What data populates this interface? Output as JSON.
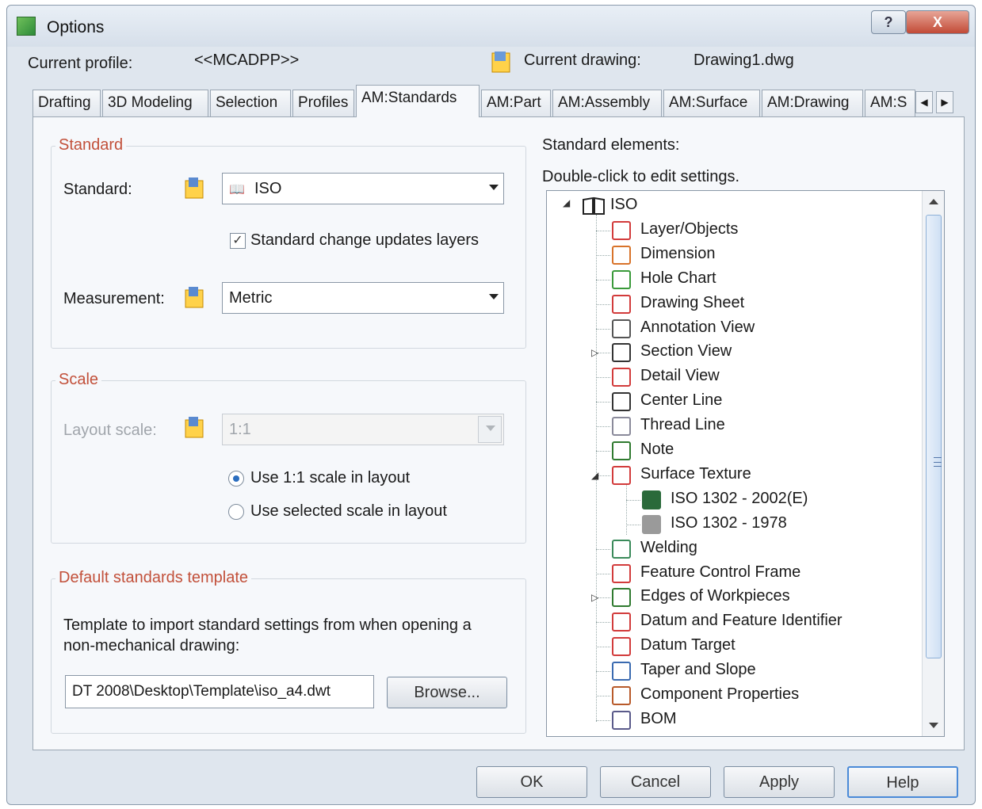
{
  "window": {
    "title": "Options"
  },
  "titlebar": {
    "help_glyph": "?",
    "close_glyph": "X"
  },
  "header": {
    "profile_label": "Current profile:",
    "profile_value": "<<MCADPP>>",
    "drawing_label": "Current drawing:",
    "drawing_value": "Drawing1.dwg"
  },
  "tabs": [
    {
      "label": "Drafting"
    },
    {
      "label": "3D Modeling"
    },
    {
      "label": "Selection"
    },
    {
      "label": "Profiles"
    },
    {
      "label": "AM:Standards",
      "active": true
    },
    {
      "label": "AM:Part"
    },
    {
      "label": "AM:Assembly"
    },
    {
      "label": "AM:Surface"
    },
    {
      "label": "AM:Drawing"
    },
    {
      "label": "AM:S"
    }
  ],
  "standard_group": {
    "heading": "Standard",
    "standard_label": "Standard:",
    "standard_value": "ISO",
    "checkbox_label": "Standard change updates layers",
    "checkbox_checked": true,
    "measurement_label": "Measurement:",
    "measurement_value": "Metric"
  },
  "scale_group": {
    "heading": "Scale",
    "layout_scale_label": "Layout scale:",
    "layout_scale_value": "1:1",
    "radio_1_label": "Use 1:1 scale in layout",
    "radio_2_label": "Use selected scale in layout",
    "selected_radio": 1
  },
  "template_group": {
    "heading": "Default standards template",
    "description_line1": "Template to import standard settings from when opening a",
    "description_line2": "non-mechanical drawing:",
    "path_value": "DT 2008\\Desktop\\Template\\iso_a4.dwt",
    "browse_label": "Browse..."
  },
  "elements": {
    "heading": "Standard elements:",
    "hint": "Double-click to edit settings.",
    "root": "ISO",
    "items": [
      {
        "label": "Layer/Objects",
        "icon": "layers-icon",
        "color": "#d23b3b"
      },
      {
        "label": "Dimension",
        "icon": "dimension-icon",
        "color": "#d8732a"
      },
      {
        "label": "Hole Chart",
        "icon": "hole-chart-icon",
        "color": "#3a9a3a"
      },
      {
        "label": "Drawing Sheet",
        "icon": "drawing-sheet-icon",
        "color": "#d23b3b"
      },
      {
        "label": "Annotation View",
        "icon": "annotation-view-icon",
        "color": "#555555"
      },
      {
        "label": "Section View",
        "icon": "section-view-icon",
        "color": "#333333"
      },
      {
        "label": "Detail View",
        "icon": "detail-view-icon",
        "color": "#d23b3b"
      },
      {
        "label": "Center Line",
        "icon": "center-line-icon",
        "color": "#333333"
      },
      {
        "label": "Thread Line",
        "icon": "thread-line-icon",
        "color": "#8a8a9a"
      },
      {
        "label": "Note",
        "icon": "note-icon",
        "color": "#2f7a2f"
      },
      {
        "label": "Surface Texture",
        "icon": "surface-texture-icon",
        "color": "#d23b3b"
      },
      {
        "label": "ISO 1302 - 2002(E)",
        "icon": "iso-1302-2002-icon",
        "color": "#2a6a3a",
        "child": true
      },
      {
        "label": "ISO 1302 - 1978",
        "icon": "iso-1302-1978-icon",
        "color": "#9a9a9a",
        "child": true
      },
      {
        "label": "Welding",
        "icon": "welding-icon",
        "color": "#3a8a5a"
      },
      {
        "label": "Feature Control Frame",
        "icon": "feature-control-frame-icon",
        "color": "#d23b3b"
      },
      {
        "label": "Edges of Workpieces",
        "icon": "edges-icon",
        "color": "#2f7a2f"
      },
      {
        "label": "Datum and Feature Identifier",
        "icon": "datum-identifier-icon",
        "color": "#d23b3b"
      },
      {
        "label": "Datum Target",
        "icon": "datum-target-icon",
        "color": "#d23b3b"
      },
      {
        "label": "Taper and Slope",
        "icon": "taper-slope-icon",
        "color": "#3a6ab0"
      },
      {
        "label": "Component Properties",
        "icon": "component-properties-icon",
        "color": "#b85a2a"
      },
      {
        "label": "BOM",
        "icon": "bom-icon",
        "color": "#5a5a8a"
      }
    ]
  },
  "footer": {
    "ok": "OK",
    "cancel": "Cancel",
    "apply": "Apply",
    "help": "Help"
  }
}
